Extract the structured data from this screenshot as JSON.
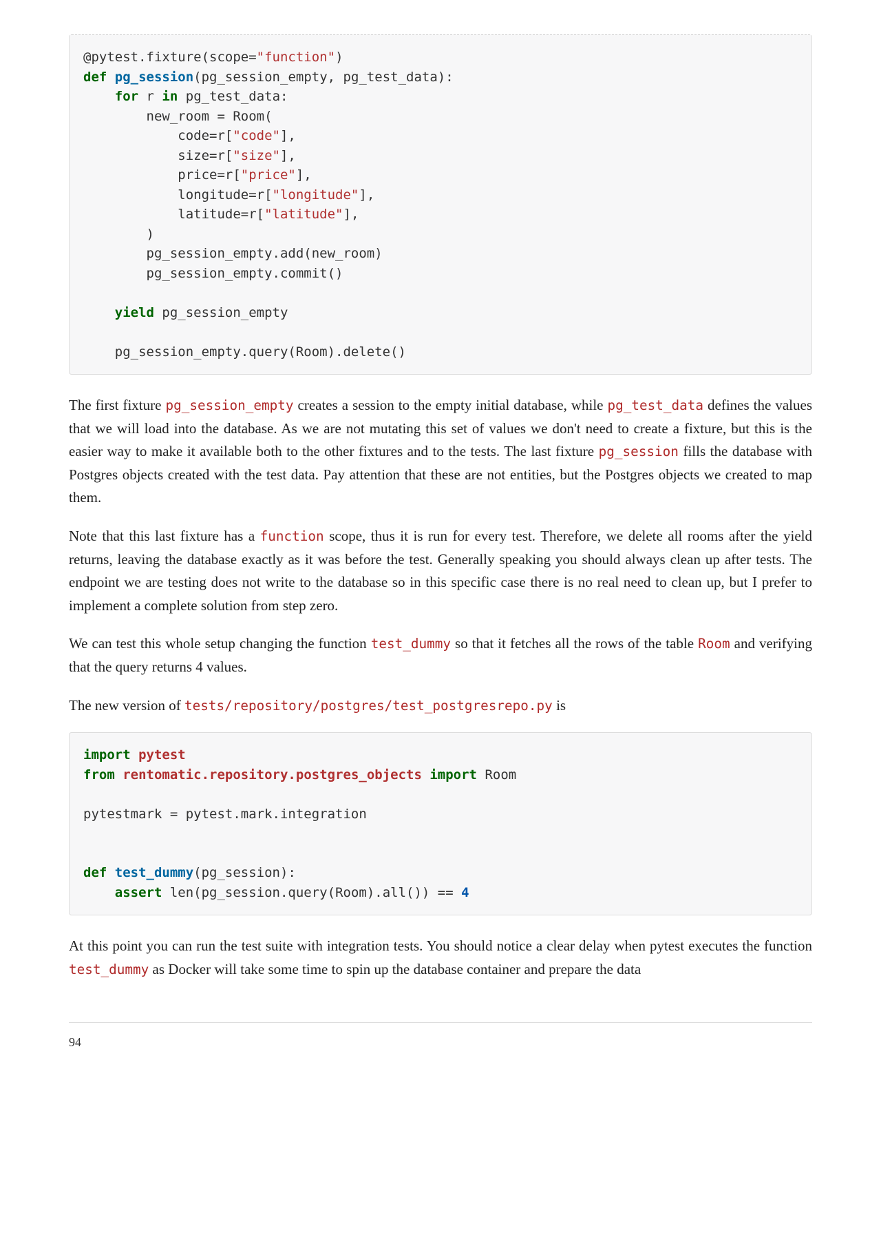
{
  "code1": {
    "dec_pre": "@pytest.fixture(scope=",
    "dec_str": "\"function\"",
    "dec_post": ")",
    "kw_def": "def",
    "fn_name": "pg_session",
    "fn_params": "(pg_session_empty, pg_test_data):",
    "kw_for": "for",
    "for_rest": " r ",
    "kw_in": "in",
    "for_tail": " pg_test_data:",
    "newroom": "        new_room = Room(",
    "code_pre": "            code=r[",
    "code_str": "\"code\"",
    "code_post": "],",
    "size_pre": "            size=r[",
    "size_str": "\"size\"",
    "size_post": "],",
    "price_pre": "            price=r[",
    "price_str": "\"price\"",
    "price_post": "],",
    "lon_pre": "            longitude=r[",
    "lon_str": "\"longitude\"",
    "lon_post": "],",
    "lat_pre": "            latitude=r[",
    "lat_str": "\"latitude\"",
    "lat_post": "],",
    "close_paren": "        )",
    "add_line": "        pg_session_empty.add(new_room)",
    "commit_line": "        pg_session_empty.commit()",
    "kw_yield": "yield",
    "yield_rest": " pg_session_empty",
    "delete_line": "    pg_session_empty.query(Room).delete()"
  },
  "para1": {
    "t1": "The first fixture ",
    "c1": "pg_session_empty",
    "t2": " creates a session to the empty initial database, while ",
    "c2": "pg_test_data",
    "t3": " defines the values that we will load into the database. As we are not mutating this set of values we don't need to create a fixture, but this is the easier way to make it available both to the other fixtures and to the tests. The last fixture ",
    "c3": "pg_session",
    "t4": " fills the database with Postgres objects created with the test data. Pay attention that these are not entities, but the Postgres objects we created to map them."
  },
  "para2": {
    "t1": "Note that this last fixture has a ",
    "c1": "function",
    "t2": " scope, thus it is run for every test. Therefore, we delete all rooms after the yield returns, leaving the database exactly as it was before the test. Generally speaking you should always clean up after tests. The endpoint we are testing does not write to the database so in this specific case there is no real need to clean up, but I prefer to implement a complete solution from step zero."
  },
  "para3": {
    "t1": "We can test this whole setup changing the function ",
    "c1": "test_dummy",
    "t2": " so that it fetches all the rows of the table ",
    "c2": "Room",
    "t3": " and verifying that the query returns 4 values."
  },
  "para4": {
    "t1": "The new version of ",
    "c1": "tests/repository/postgres/test_postgresrepo.py",
    "t2": " is"
  },
  "code2": {
    "kw_import": "import",
    "mod_pytest": "pytest",
    "kw_from": "from",
    "mod_path": "rentomatic.repository.postgres_objects",
    "kw_import2": "import",
    "import_room": " Room",
    "mark_line": "pytestmark = pytest.mark.integration",
    "kw_def": "def",
    "fn_name": "test_dummy",
    "fn_params": "(pg_session):",
    "kw_assert": "assert",
    "assert_mid": " len(pg_session.query(Room).all()) == ",
    "num_four": "4"
  },
  "para5": {
    "t1": "At this point you can run the test suite with integration tests. You should notice a clear delay when pytest executes the function ",
    "c1": "test_dummy",
    "t2": " as Docker will take some time to spin up the database container and prepare the data"
  },
  "page_number": "94"
}
